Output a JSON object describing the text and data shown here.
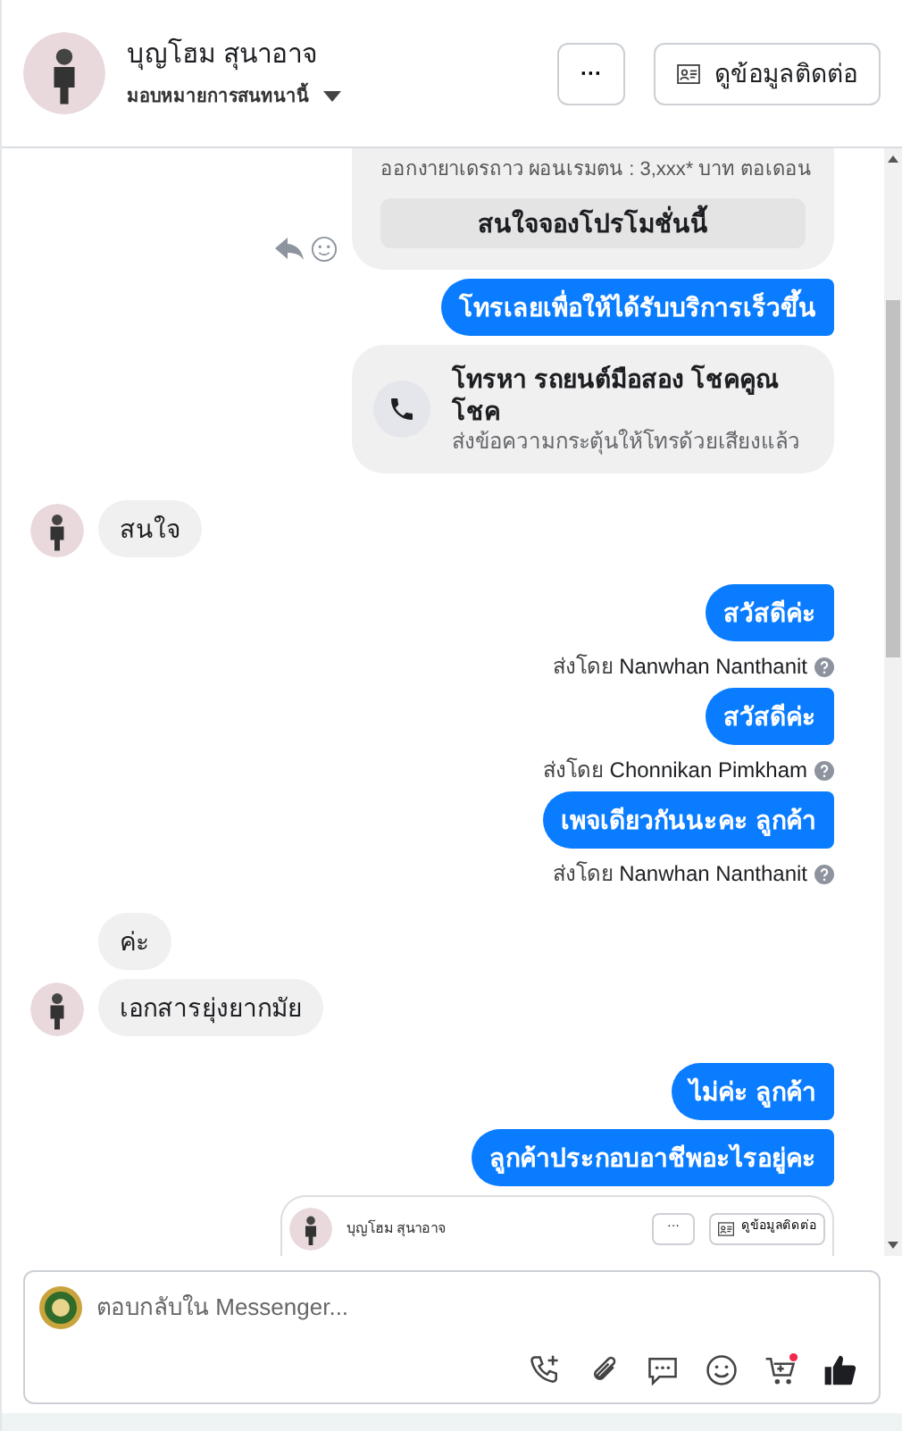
{
  "header": {
    "name": "บุญโฮม สุนาอาจ",
    "assign": "มอบหมายการสนทนานี้",
    "more_button": "···",
    "contact_button": "ดูข้อมูลติดต่อ"
  },
  "messages": [
    {
      "kind": "promo",
      "text": "ออกงายาเดรถาว ผอนเรมตน : 3,xxx* บาท ตอเดอน",
      "button": "สนใจจองโปรโมชั่นนี้"
    },
    {
      "kind": "outgoing",
      "text": "โทรเลยเพื่อให้ได้รับบริการเร็วขึ้น"
    },
    {
      "kind": "call",
      "title": "โทรหา รถยนต์มือสอง โชคคูณ โชค",
      "subtitle": "ส่งข้อความกระตุ้นให้โทรด้วยเสียงแล้ว"
    },
    {
      "kind": "incoming",
      "text": "สนใจ",
      "avatar": true
    },
    {
      "kind": "outgoing",
      "text": "สวัสดีค่ะ"
    },
    {
      "kind": "note",
      "prefix": "ส่งโดย",
      "sender": "Nanwhan Nanthanit"
    },
    {
      "kind": "outgoing",
      "text": "สวัสดีค่ะ"
    },
    {
      "kind": "note",
      "prefix": "ส่งโดย",
      "sender": "Chonnikan Pimkham"
    },
    {
      "kind": "outgoing",
      "text": "เพจเดียวกันนะคะ ลูกค้า"
    },
    {
      "kind": "note",
      "prefix": "ส่งโดย",
      "sender": "Nanwhan Nanthanit"
    },
    {
      "kind": "incoming",
      "text": "ค่ะ",
      "avatar": false
    },
    {
      "kind": "incoming",
      "text": "เอกสารยุ่งยากมัย",
      "avatar": true
    },
    {
      "kind": "outgoing",
      "text": "ไม่ค่ะ ลูกค้า"
    },
    {
      "kind": "outgoing",
      "text": "ลูกค้าประกอบอาชีพอะไรอยู่คะ"
    },
    {
      "kind": "embed",
      "name": "บุญโฮม สุนาอาจ",
      "more_button": "···",
      "contact_button": "ดูข้อมูลติดต่อ"
    }
  ],
  "composer": {
    "placeholder": "ตอบกลับใน Messenger..."
  }
}
